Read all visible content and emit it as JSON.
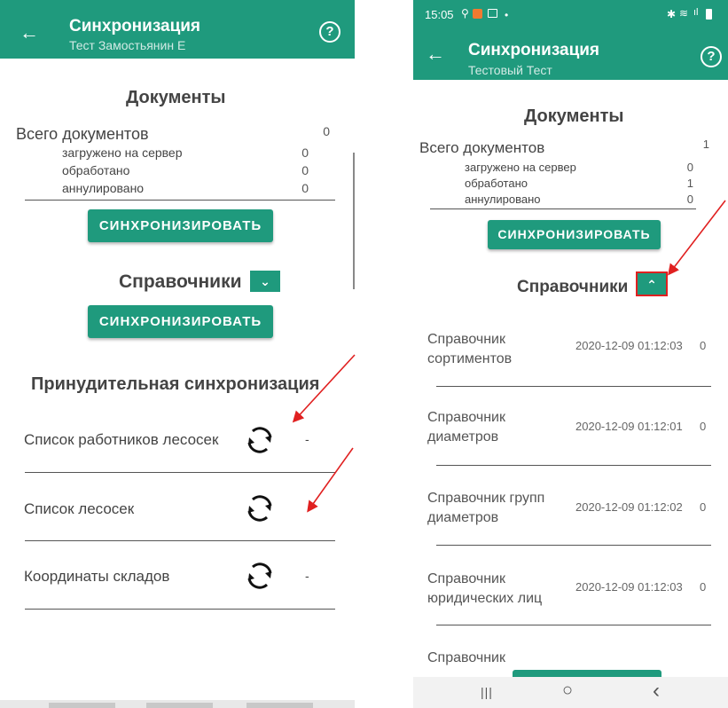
{
  "left": {
    "title": "Синхронизация",
    "subtitle": "Тест  Замостьянин Е",
    "help": "?",
    "docs_heading": "Документы",
    "total_label": "Всего документов",
    "total_value": "0",
    "uploaded_label": "загружено на сервер",
    "uploaded_value": "0",
    "processed_label": "обработано",
    "processed_value": "0",
    "cancelled_label": "аннулировано",
    "cancelled_value": "0",
    "sync_button": "СИНХРОНИЗИРОВАТЬ",
    "refs_heading": "Справочники",
    "refs_sync_button": "СИНХРОНИЗИРОВАТЬ",
    "force_heading": "Принудительная синхронизация",
    "force_items": [
      {
        "label": "Список работников лесосек",
        "value": "-"
      },
      {
        "label": "Список лесосек",
        "value": ""
      },
      {
        "label": "Координаты складов",
        "value": "-"
      }
    ]
  },
  "right": {
    "status_time": "15:05",
    "title": "Синхронизация",
    "subtitle": "Тестовый Тест",
    "help": "?",
    "docs_heading": "Документы",
    "total_label": "Всего документов",
    "total_value": "1",
    "uploaded_label": "загружено на сервер",
    "uploaded_value": "0",
    "processed_label": "обработано",
    "processed_value": "1",
    "cancelled_label": "аннулировано",
    "cancelled_value": "0",
    "sync_button": "СИНХРОНИЗИРОВАТЬ",
    "refs_heading": "Справочники",
    "refs": [
      {
        "name": "Справочник сортиментов",
        "date": "2020-12-09 01:12:03",
        "count": "0"
      },
      {
        "name": "Справочник диаметров",
        "date": "2020-12-09 01:12:01",
        "count": "0"
      },
      {
        "name": "Справочник групп диаметров",
        "date": "2020-12-09 01:12:02",
        "count": "0"
      },
      {
        "name": "Справочник юридических лиц",
        "date": "2020-12-09 01:12:03",
        "count": "0"
      },
      {
        "name": "Справочник",
        "date": "",
        "count": ""
      }
    ],
    "nav": {
      "recent": "|||",
      "home": "○",
      "back": "‹"
    }
  },
  "colors": {
    "accent": "#1f9a7d",
    "annotation": "#e02020"
  }
}
